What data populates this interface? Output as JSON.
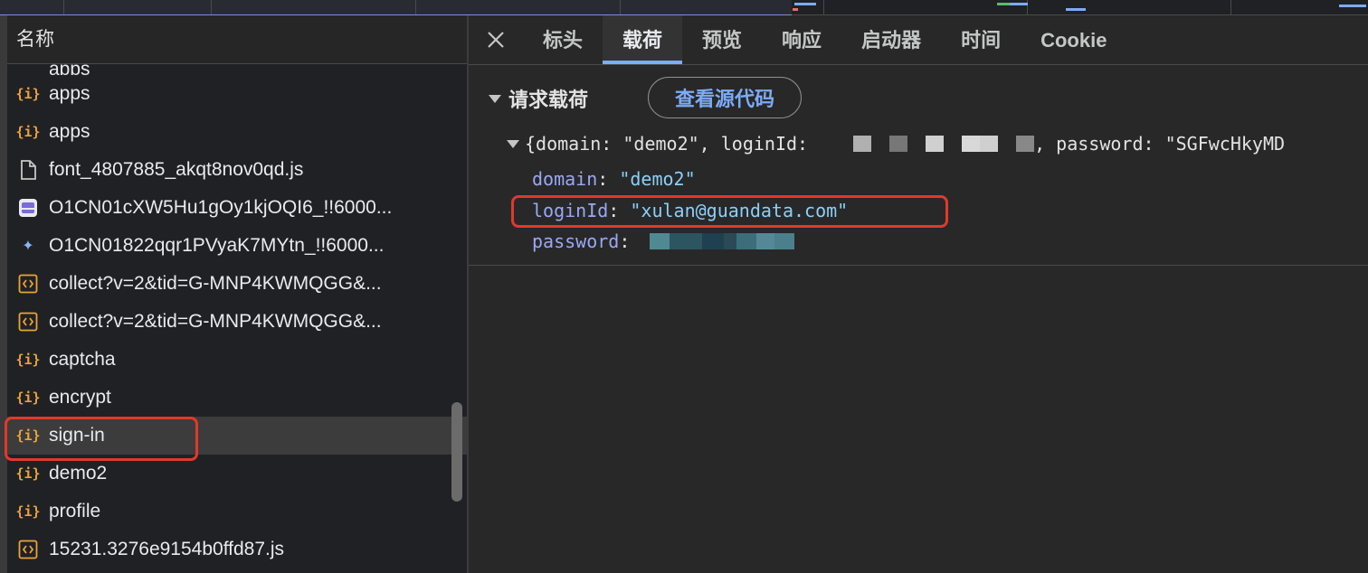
{
  "request_list": {
    "header": "名称",
    "partial_top": "apps",
    "items": [
      {
        "name": "apps",
        "icon": "json-icon"
      },
      {
        "name": "apps",
        "icon": "json-icon"
      },
      {
        "name": "font_4807885_akqt8nov0qd.js",
        "icon": "document-icon"
      },
      {
        "name": "O1CN01cXW5Hu1gOy1kjOQI6_!!6000...",
        "icon": "image-icon"
      },
      {
        "name": "O1CN01822qqr1PVyaK7MYtn_!!6000...",
        "icon": "star-icon"
      },
      {
        "name": "collect?v=2&tid=G-MNP4KWMQGG&...",
        "icon": "code-icon"
      },
      {
        "name": "collect?v=2&tid=G-MNP4KWMQGG&...",
        "icon": "code-icon"
      },
      {
        "name": "captcha",
        "icon": "json-icon"
      },
      {
        "name": "encrypt",
        "icon": "json-icon"
      },
      {
        "name": "sign-in",
        "icon": "json-icon",
        "selected": true
      },
      {
        "name": "demo2",
        "icon": "json-icon"
      },
      {
        "name": "profile",
        "icon": "json-icon"
      },
      {
        "name": "15231.3276e9154b0ffd87.js",
        "icon": "code-icon"
      }
    ]
  },
  "detail": {
    "tabs": [
      {
        "label": "标头"
      },
      {
        "label": "载荷",
        "active": true
      },
      {
        "label": "预览"
      },
      {
        "label": "响应"
      },
      {
        "label": "启动器"
      },
      {
        "label": "时间"
      },
      {
        "label": "Cookie"
      }
    ],
    "section_title": "请求载荷",
    "view_source": "查看源代码",
    "summary_prefix": "{domain: \"demo2\", loginId:",
    "summary_suffix": ", password: \"SGFwcHkyMD",
    "fields": {
      "domain_key": "domain",
      "domain_value": "\"demo2\"",
      "loginid_key": "loginId",
      "loginid_value": "\"xulan@guandata.com\"",
      "password_key": "password"
    }
  },
  "colors": {
    "highlight": "#e0392b",
    "accent": "#7cacf8",
    "json_icon": "#e8a33d"
  }
}
